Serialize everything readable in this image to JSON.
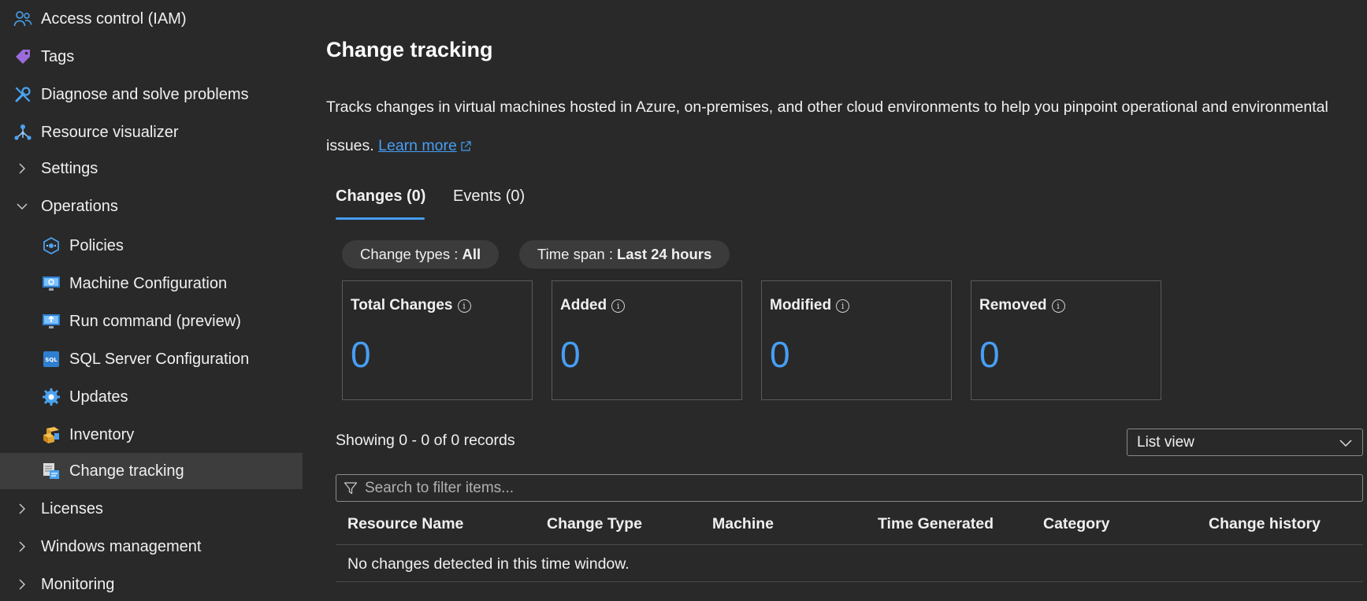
{
  "sidebar": {
    "items": [
      {
        "label": "Access control (IAM)",
        "icon": "people-icon"
      },
      {
        "label": "Tags",
        "icon": "tag-icon"
      },
      {
        "label": "Diagnose and solve problems",
        "icon": "wrench-icon"
      },
      {
        "label": "Resource visualizer",
        "icon": "hierarchy-icon"
      },
      {
        "label": "Settings",
        "icon": "chevron-right-icon"
      },
      {
        "label": "Operations",
        "icon": "chevron-down-icon"
      },
      {
        "label": "Policies",
        "icon": "policy-icon"
      },
      {
        "label": "Machine Configuration",
        "icon": "machine-config-icon"
      },
      {
        "label": "Run command (preview)",
        "icon": "run-command-icon"
      },
      {
        "label": "SQL Server Configuration",
        "icon": "sql-icon"
      },
      {
        "label": "Updates",
        "icon": "updates-gear-icon"
      },
      {
        "label": "Inventory",
        "icon": "inventory-box-icon"
      },
      {
        "label": "Change tracking",
        "icon": "change-tracking-icon",
        "selected": true
      },
      {
        "label": "Licenses",
        "icon": "chevron-right-icon"
      },
      {
        "label": "Windows management",
        "icon": "chevron-right-icon"
      },
      {
        "label": "Monitoring",
        "icon": "chevron-right-icon"
      }
    ],
    "sql_icon_text": "SQL"
  },
  "main": {
    "title": "Change tracking",
    "description": "Tracks changes in virtual machines hosted in Azure, on-premises, and other cloud environments to help you pinpoint operational and environmental issues.",
    "learn_more": "Learn more",
    "tabs": [
      {
        "label": "Changes (0)",
        "active": true
      },
      {
        "label": "Events (0)",
        "active": false
      }
    ],
    "filters": {
      "change_types_label": "Change types :",
      "change_types_value": "All",
      "time_span_label": "Time span :",
      "time_span_value": "Last 24 hours"
    },
    "cards": [
      {
        "title": "Total Changes",
        "value": "0"
      },
      {
        "title": "Added",
        "value": "0"
      },
      {
        "title": "Modified",
        "value": "0"
      },
      {
        "title": "Removed",
        "value": "0"
      }
    ],
    "info_glyph": "i",
    "showing": "Showing 0 - 0 of 0 records",
    "view_select": "List view",
    "search_placeholder": "Search to filter items...",
    "columns": [
      "Resource Name",
      "Change Type",
      "Machine",
      "Time Generated",
      "Category",
      "Change history"
    ],
    "empty_message": "No changes detected in this time window."
  },
  "colors": {
    "background": "#292929",
    "accent": "#479ef5",
    "selected_nav": "#3d3d3d"
  }
}
